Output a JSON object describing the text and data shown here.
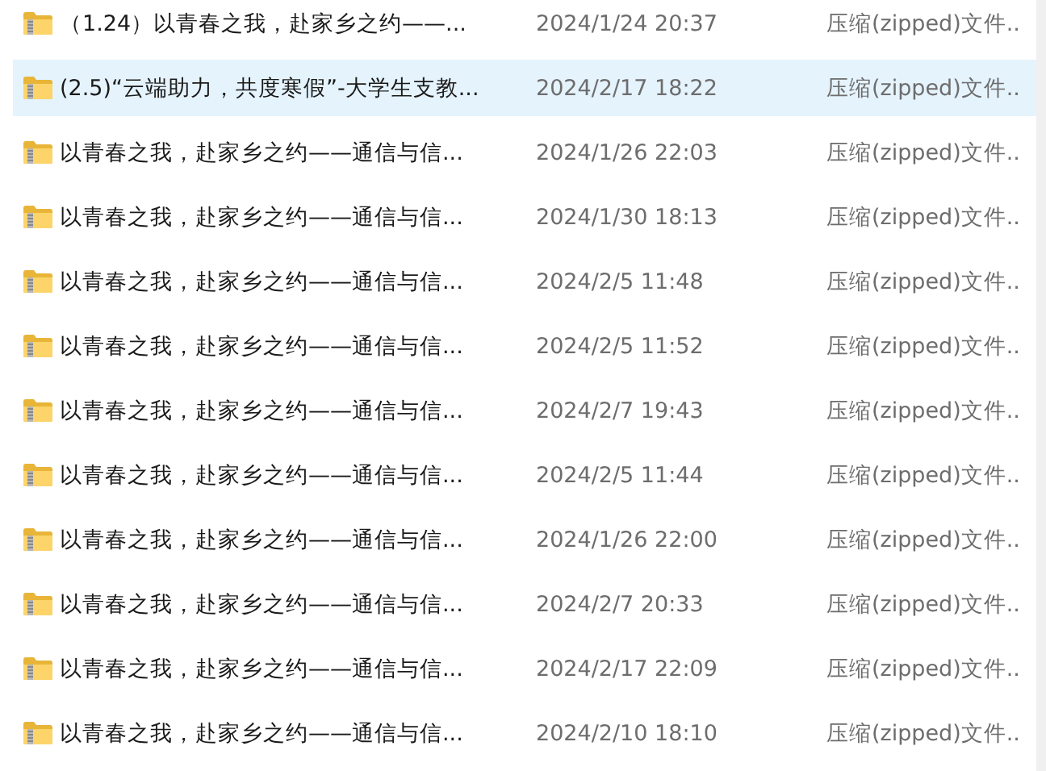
{
  "files": [
    {
      "name": "（1.24）以青春之我，赴家乡之约——...",
      "date": "2024/1/24 20:37",
      "type": "压缩(zipped)文件..",
      "selected": false
    },
    {
      "name": "(2.5)“云端助力，共度寒假”-大学生支教...",
      "date": "2024/2/17 18:22",
      "type": "压缩(zipped)文件..",
      "selected": true
    },
    {
      "name": "以青春之我，赴家乡之约——通信与信...",
      "date": "2024/1/26 22:03",
      "type": "压缩(zipped)文件..",
      "selected": false
    },
    {
      "name": "以青春之我，赴家乡之约——通信与信...",
      "date": "2024/1/30 18:13",
      "type": "压缩(zipped)文件..",
      "selected": false
    },
    {
      "name": "以青春之我，赴家乡之约——通信与信...",
      "date": "2024/2/5 11:48",
      "type": "压缩(zipped)文件..",
      "selected": false
    },
    {
      "name": "以青春之我，赴家乡之约——通信与信...",
      "date": "2024/2/5 11:52",
      "type": "压缩(zipped)文件..",
      "selected": false
    },
    {
      "name": "以青春之我，赴家乡之约——通信与信...",
      "date": "2024/2/7 19:43",
      "type": "压缩(zipped)文件..",
      "selected": false
    },
    {
      "name": "以青春之我，赴家乡之约——通信与信...",
      "date": "2024/2/5 11:44",
      "type": "压缩(zipped)文件..",
      "selected": false
    },
    {
      "name": "以青春之我，赴家乡之约——通信与信...",
      "date": "2024/1/26 22:00",
      "type": "压缩(zipped)文件..",
      "selected": false
    },
    {
      "name": "以青春之我，赴家乡之约——通信与信...",
      "date": "2024/2/7 20:33",
      "type": "压缩(zipped)文件..",
      "selected": false
    },
    {
      "name": "以青春之我，赴家乡之约——通信与信...",
      "date": "2024/2/17 22:09",
      "type": "压缩(zipped)文件..",
      "selected": false
    },
    {
      "name": "以青春之我，赴家乡之约——通信与信...",
      "date": "2024/2/10 18:10",
      "type": "压缩(zipped)文件..",
      "selected": false
    }
  ]
}
